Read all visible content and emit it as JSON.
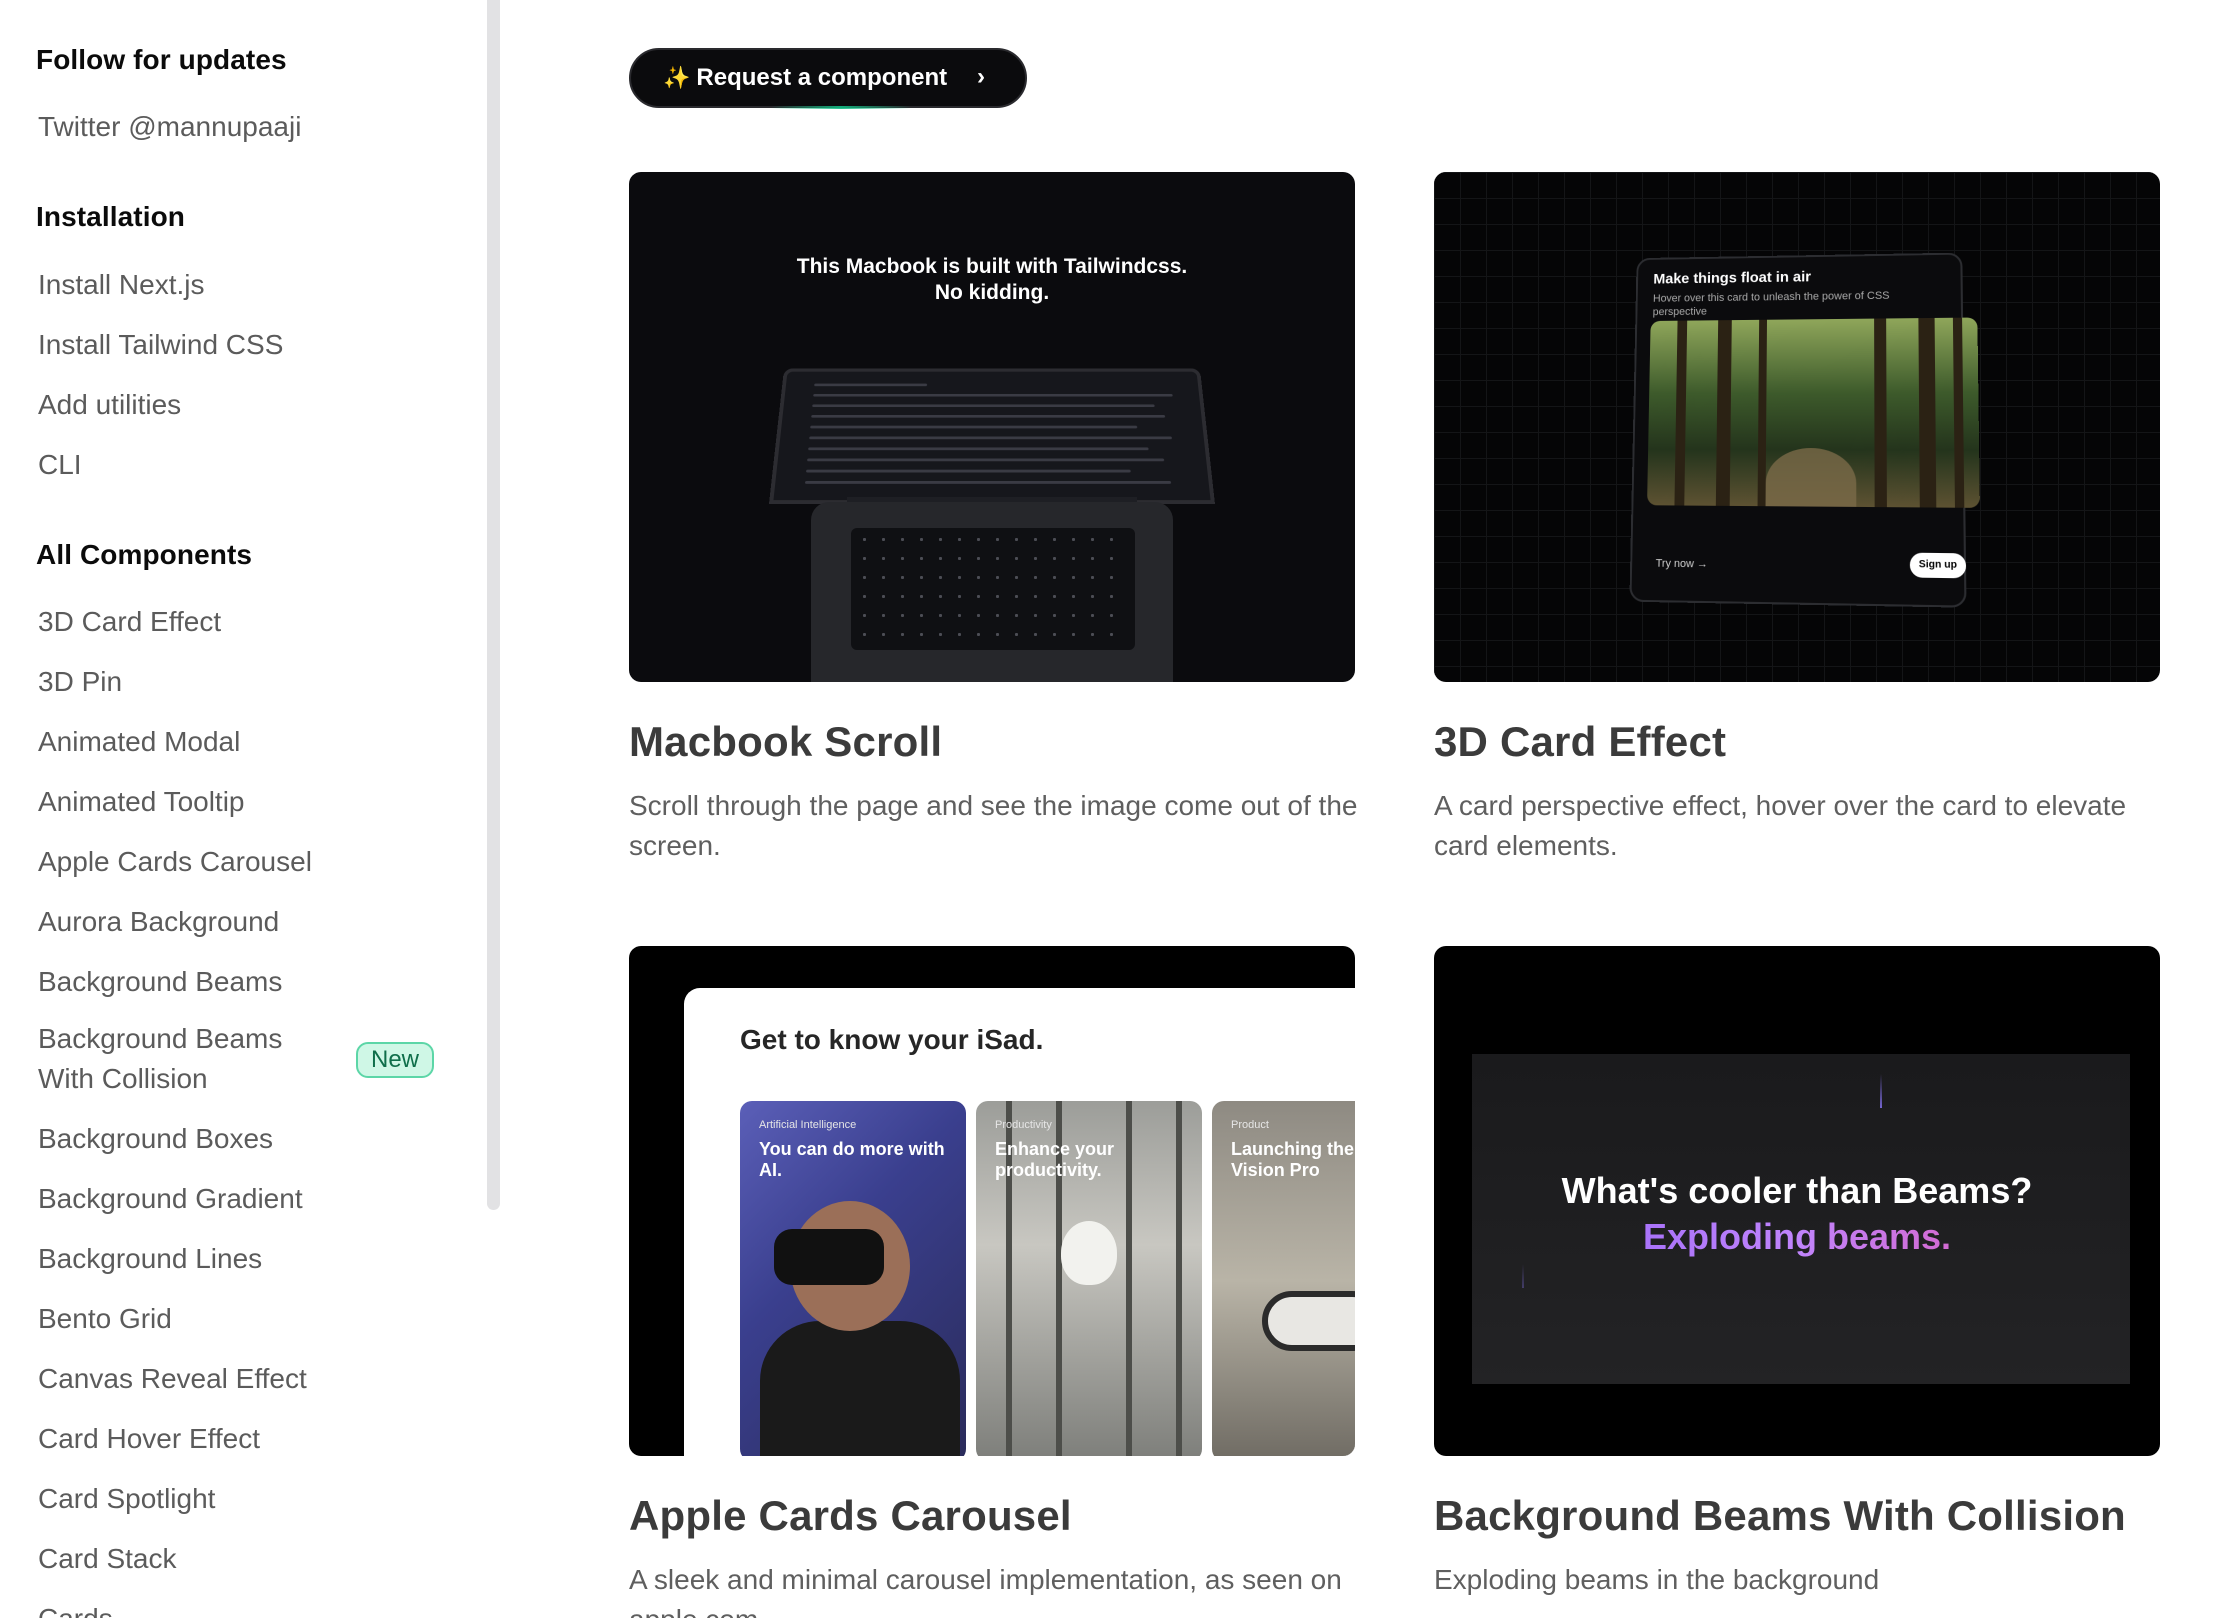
{
  "sidebar": {
    "follow_heading": "Follow for updates",
    "twitter_link": "Twitter @mannupaaji",
    "installation_heading": "Installation",
    "installation_items": [
      "Install Next.js",
      "Install Tailwind CSS",
      "Add utilities",
      "CLI"
    ],
    "components_heading": "All Components",
    "components": [
      "3D Card Effect",
      "3D Pin",
      "Animated Modal",
      "Animated Tooltip",
      "Apple Cards Carousel",
      "Aurora Background",
      "Background Beams",
      "Background Beams With Collision",
      "Background Boxes",
      "Background Gradient",
      "Background Lines",
      "Bento Grid",
      "Canvas Reveal Effect",
      "Card Hover Effect",
      "Card Spotlight",
      "Card Stack",
      "Cards"
    ],
    "new_badge": "New"
  },
  "request_button": {
    "icon": "sparkles-icon",
    "label": "Request a component",
    "chevron": "›"
  },
  "cards": [
    {
      "title": "Macbook Scroll",
      "description": "Scroll through the page and see the image come out of the screen.",
      "preview": {
        "caption_line1": "This Macbook is built with Tailwindcss.",
        "caption_line2": "No kidding."
      }
    },
    {
      "title": "3D Card Effect",
      "description": "A card perspective effect, hover over the card to elevate card elements.",
      "preview": {
        "card_title": "Make things float in air",
        "card_subtitle": "Hover over this card to unleash the power of CSS perspective",
        "try_now": "Try now →",
        "sign_up": "Sign up"
      }
    },
    {
      "title": "Apple Cards Carousel",
      "description": "A sleek and minimal carousel implementation, as seen on apple.com",
      "preview": {
        "heading": "Get to know your iSad.",
        "items": [
          {
            "category": "Artificial Intelligence",
            "text": "You can do more with AI."
          },
          {
            "category": "Productivity",
            "text": "Enhance your productivity."
          },
          {
            "category": "Product",
            "text": "Launching the Apple Vision Pro"
          }
        ]
      }
    },
    {
      "title": "Background Beams With Collision",
      "description": "Exploding beams in the background",
      "preview": {
        "line1": "What's cooler than Beams?",
        "line2": "Exploding beams."
      }
    }
  ],
  "colors": {
    "badge_bg": "#cff7e6",
    "badge_border": "#5cd6a7",
    "beams_gradient": [
      "#8b5cf6",
      "#c084fc",
      "#ec4899"
    ]
  }
}
